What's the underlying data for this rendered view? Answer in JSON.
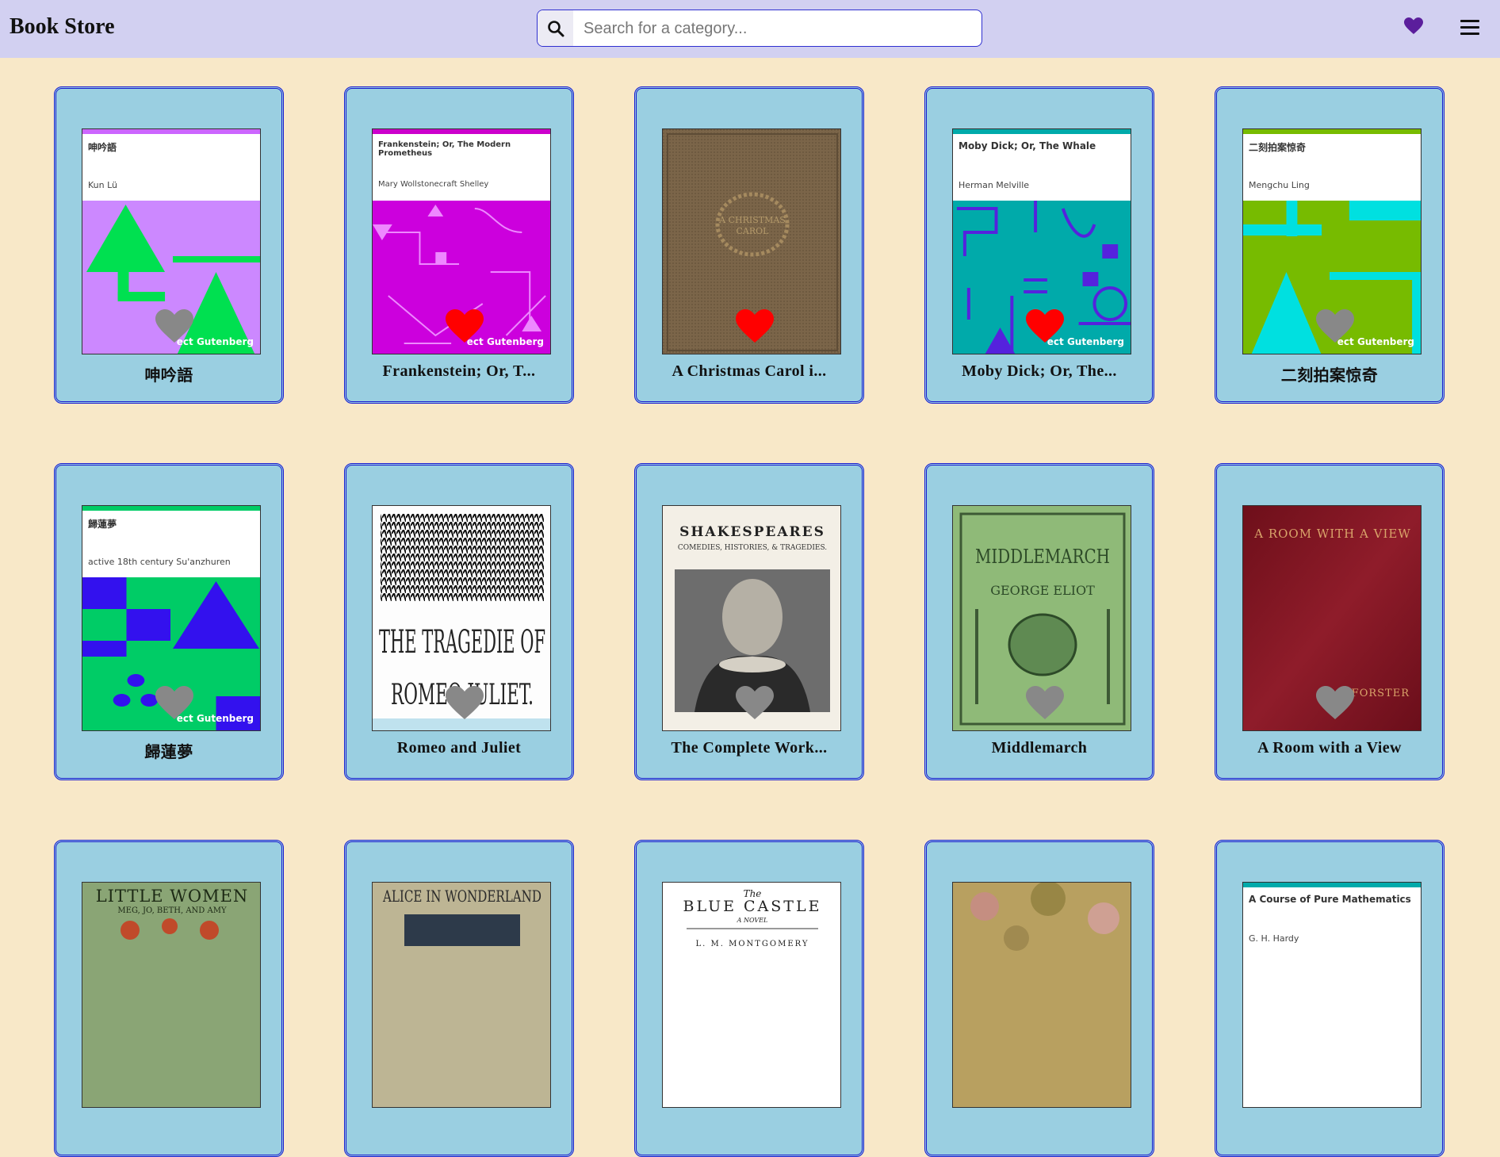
{
  "header": {
    "brand": "Book Store",
    "search_placeholder": "Search for a category...",
    "favorites_icon": "heart-icon",
    "menu_icon": "hamburger-icon"
  },
  "books": [
    {
      "title": "呻吟語",
      "cover_title": "呻吟語",
      "cover_author": "Kun Lü",
      "favorited": false
    },
    {
      "title": "Frankenstein; Or, T...",
      "cover_title": "Frankenstein; Or, The Modern Prometheus",
      "cover_author": "Mary Wollstonecraft Shelley",
      "favorited": true
    },
    {
      "title": "A Christmas Carol i...",
      "favorited": true
    },
    {
      "title": "Moby Dick; Or, The...",
      "cover_title": "Moby Dick; Or, The Whale",
      "cover_author": "Herman Melville",
      "favorited": true
    },
    {
      "title": "二刻拍案惊奇",
      "cover_title": "二刻拍案惊奇",
      "cover_author": "Mengchu Ling",
      "favorited": false
    },
    {
      "title": "歸蓮夢",
      "cover_title": "歸蓮夢",
      "cover_author": "active 18th century Su'anzhuren",
      "favorited": false
    },
    {
      "title": "Romeo and Juliet",
      "cover_text": "THE TRAGEDIE OF ROMEO JULIET.",
      "favorited": false
    },
    {
      "title": "The Complete Work...",
      "cover_text": "SHAKESPEARES",
      "favorited": false
    },
    {
      "title": "Middlemarch",
      "cover_text": "MIDDLEMARCH",
      "favorited": false
    },
    {
      "title": "A Room with a View",
      "cover_text": "A ROOM WITH A VIEW",
      "favorited": false
    },
    {
      "title": "",
      "cover_text": "LITTLE WOMEN",
      "cover_sub": "MEG, JO, BETH, AND AMY"
    },
    {
      "title": "",
      "cover_text": "ALICE IN WONDERLAND"
    },
    {
      "title": "",
      "cover_text": "BLUE CASTLE",
      "cover_sub": "The"
    },
    {
      "title": ""
    },
    {
      "title": "",
      "cover_title": "A Course of Pure Mathematics",
      "cover_author": "G. H. Hardy"
    }
  ],
  "watermark": "ect Gutenberg",
  "colors": {
    "favorite": "#ff0000",
    "not_favorite": "#888888",
    "header_heart": "#5b1e9c"
  }
}
